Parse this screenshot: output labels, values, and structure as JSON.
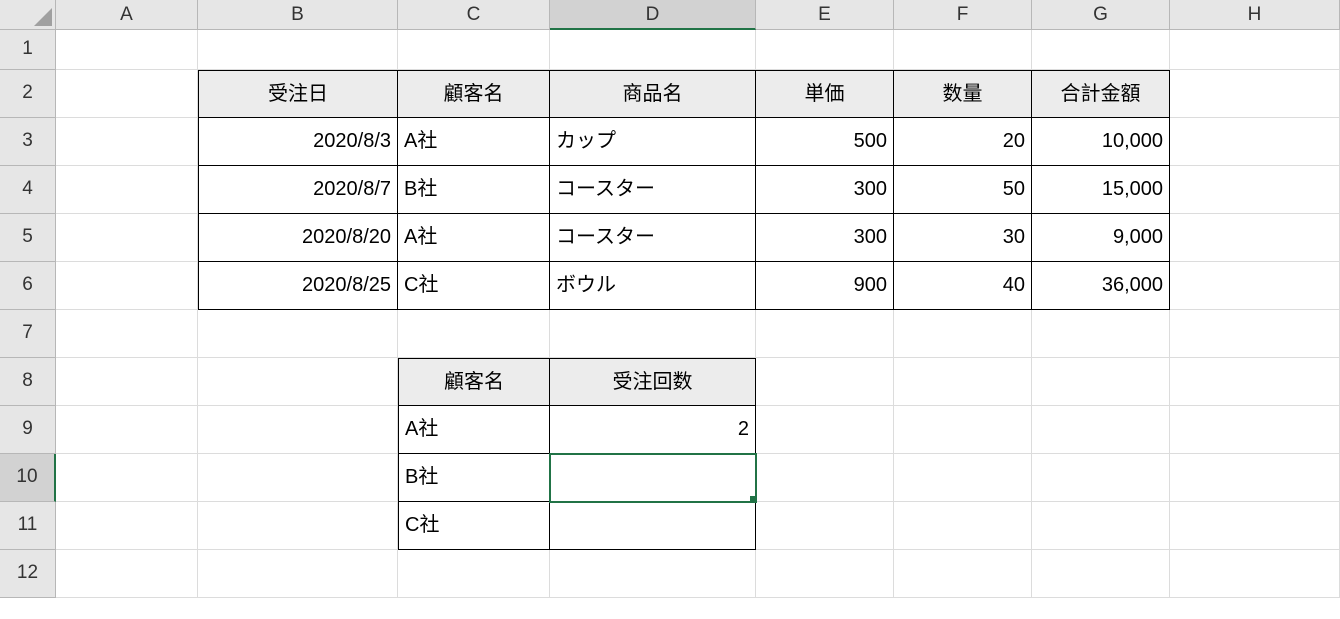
{
  "columns": [
    "A",
    "B",
    "C",
    "D",
    "E",
    "F",
    "G",
    "H"
  ],
  "rows": [
    "1",
    "2",
    "3",
    "4",
    "5",
    "6",
    "7",
    "8",
    "9",
    "10",
    "11",
    "12"
  ],
  "selectedCell": "D10",
  "table1": {
    "headers": {
      "B": "受注日",
      "C": "顧客名",
      "D": "商品名",
      "E": "単価",
      "F": "数量",
      "G": "合計金額"
    },
    "rows": [
      {
        "date": "2020/8/3",
        "customer": "A社",
        "product": "カップ",
        "price": "500",
        "qty": "20",
        "total": "10,000"
      },
      {
        "date": "2020/8/7",
        "customer": "B社",
        "product": "コースター",
        "price": "300",
        "qty": "50",
        "total": "15,000"
      },
      {
        "date": "2020/8/20",
        "customer": "A社",
        "product": "コースター",
        "price": "300",
        "qty": "30",
        "total": "9,000"
      },
      {
        "date": "2020/8/25",
        "customer": "C社",
        "product": "ボウル",
        "price": "900",
        "qty": "40",
        "total": "36,000"
      }
    ]
  },
  "table2": {
    "headers": {
      "C": "顧客名",
      "D": "受注回数"
    },
    "rows": [
      {
        "customer": "A社",
        "count": "2"
      },
      {
        "customer": "B社",
        "count": ""
      },
      {
        "customer": "C社",
        "count": ""
      }
    ]
  }
}
